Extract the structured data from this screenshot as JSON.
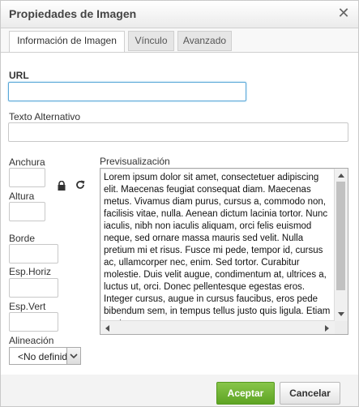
{
  "dialog": {
    "title": "Propiedades de Imagen"
  },
  "tabs": [
    {
      "label": "Información de Imagen",
      "active": true
    },
    {
      "label": "Vínculo",
      "active": false
    },
    {
      "label": "Avanzado",
      "active": false
    }
  ],
  "form": {
    "url_label": "URL",
    "url_value": "",
    "alt_label": "Texto Alternativo",
    "alt_value": "",
    "width_label": "Anchura",
    "height_label": "Altura",
    "border_label": "Borde",
    "hspace_label": "Esp.Horiz",
    "vspace_label": "Esp.Vert",
    "align_label": "Alineación",
    "align_value": "<No definido>"
  },
  "preview": {
    "label": "Previsualización",
    "text": "Lorem ipsum dolor sit amet, consectetuer adipiscing elit. Maecenas feugiat consequat diam. Maecenas metus. Vivamus diam purus, cursus a, commodo non, facilisis vitae, nulla. Aenean dictum lacinia tortor. Nunc iaculis, nibh non iaculis aliquam, orci felis euismod neque, sed ornare massa mauris sed velit. Nulla pretium mi et risus. Fusce mi pede, tempor id, cursus ac, ullamcorper nec, enim. Sed tortor. Curabitur molestie. Duis velit augue, condimentum at, ultrices a, luctus ut, orci. Donec pellentesque egestas eros. Integer cursus, augue in cursus faucibus, eros pede bibendum sem, in tempus tellus justo quis ligula. Etiam eget"
  },
  "footer": {
    "ok_label": "Aceptar",
    "cancel_label": "Cancelar"
  },
  "colors": {
    "accent_focus": "#59a7d8",
    "ok_button": "#6cb12f"
  },
  "icons": [
    "close-icon",
    "lock-icon",
    "reset-size-icon",
    "chevron-down-icon",
    "scroll-up-icon",
    "scroll-down-icon",
    "scroll-left-icon",
    "scroll-right-icon"
  ]
}
